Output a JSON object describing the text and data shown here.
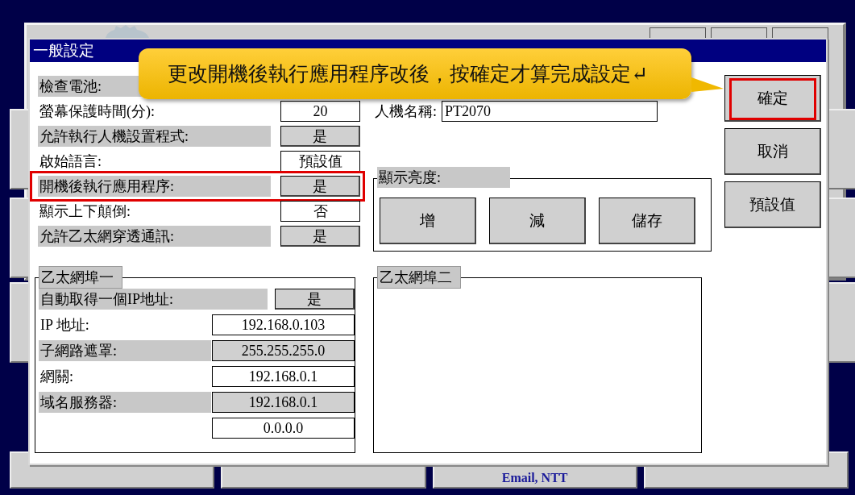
{
  "dialog": {
    "title": "一般設定",
    "settings": [
      {
        "label": "檢查電池:",
        "kind": "hidden"
      },
      {
        "label": "螢幕保護時間(分):",
        "value": "20",
        "kind": "field"
      },
      {
        "label": "允許執行人機設置程式:",
        "value": "是",
        "kind": "toggle"
      },
      {
        "label": "啟始語言:",
        "value": "預設值",
        "kind": "field"
      },
      {
        "label": "開機後執行應用程序:",
        "value": "是",
        "kind": "toggle",
        "highlighted": true
      },
      {
        "label": "顯示上下顛倒:",
        "value": "否",
        "kind": "field"
      },
      {
        "label": "允許乙太網穿透通訊:",
        "value": "是",
        "kind": "toggle"
      }
    ],
    "hmi_name": {
      "label": "人機名稱:",
      "value": "PT2070"
    },
    "brightness": {
      "title": "顯示亮度:",
      "buttons": [
        "增",
        "減",
        "儲存"
      ]
    },
    "ethernet_1": {
      "title": "乙太網埠一",
      "rows": [
        {
          "label": "自動取得一個IP地址:",
          "value": "是",
          "kind": "toggle"
        },
        {
          "label": "IP 地址:",
          "value": "192.168.0.103",
          "kind": "field"
        },
        {
          "label": "子網路遮罩:",
          "value": "255.255.255.0",
          "kind": "readonly"
        },
        {
          "label": "網關:",
          "value": "192.168.0.1",
          "kind": "field"
        },
        {
          "label": "域名服務器:",
          "value": "192.168.0.1",
          "kind": "readonly"
        },
        {
          "value": "0.0.0.0",
          "kind": "field"
        }
      ]
    },
    "ethernet_2": {
      "title": "乙太網埠二"
    },
    "buttons": [
      {
        "label": "確定",
        "highlighted": true
      },
      {
        "label": "取消",
        "highlighted": false
      },
      {
        "label": "預設值",
        "highlighted": false
      }
    ]
  },
  "callout": "更改開機後執行應用程序改後，按確定才算完成設定↵",
  "background_text": "Email, NTT"
}
